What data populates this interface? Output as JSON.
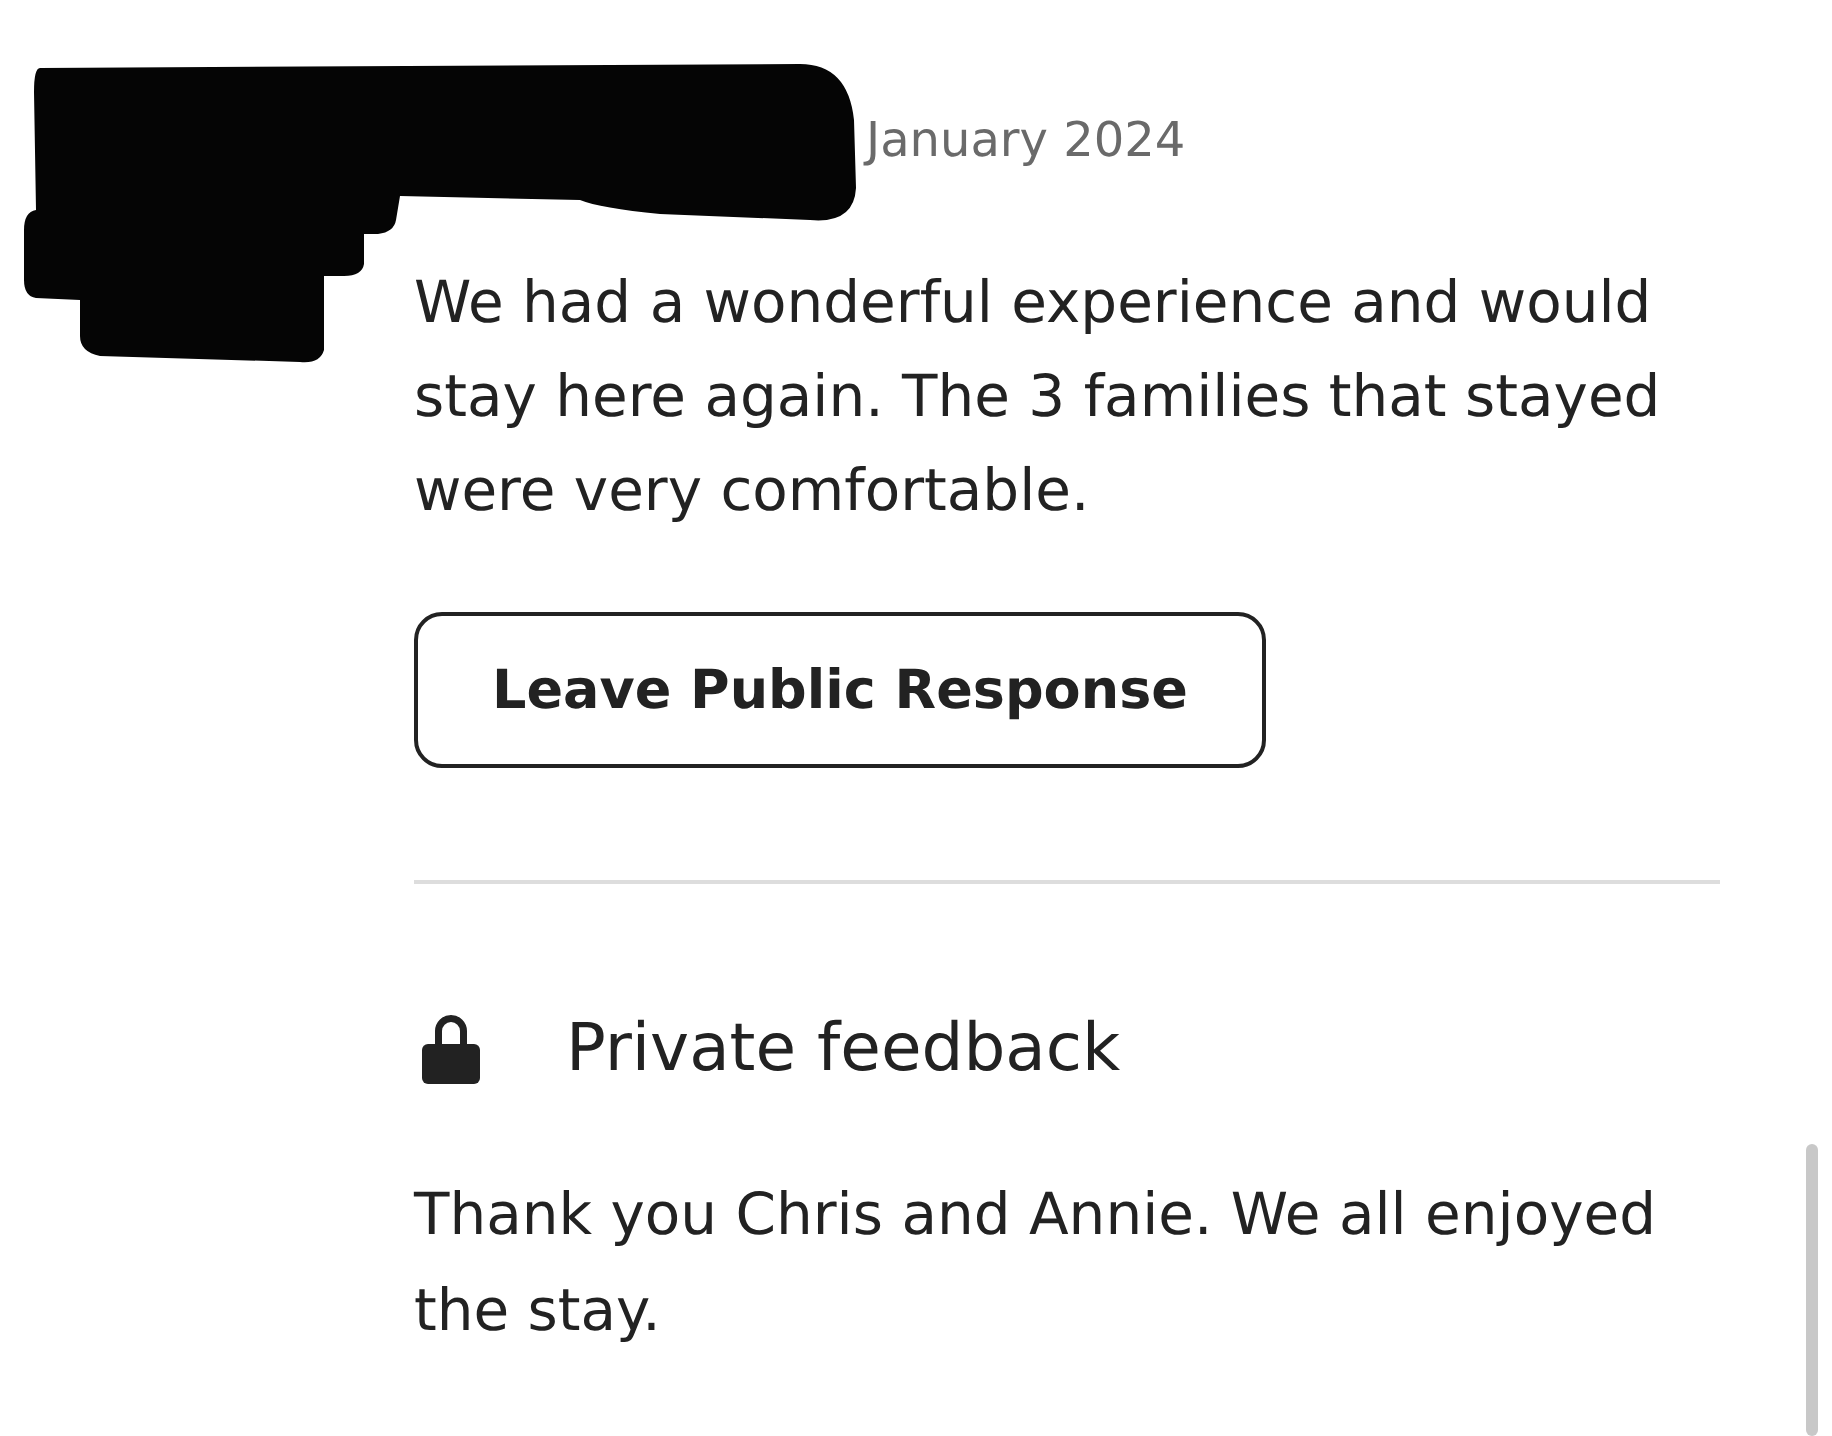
{
  "review": {
    "date": "January 2024",
    "text": "We had a wonderful experience and would stay here again. The 3 families that stayed were very comfortable.",
    "response_button": "Leave Public Response"
  },
  "private_feedback": {
    "title": "Private feedback",
    "text": "Thank you Chris and Annie. We all enjoyed the stay."
  }
}
